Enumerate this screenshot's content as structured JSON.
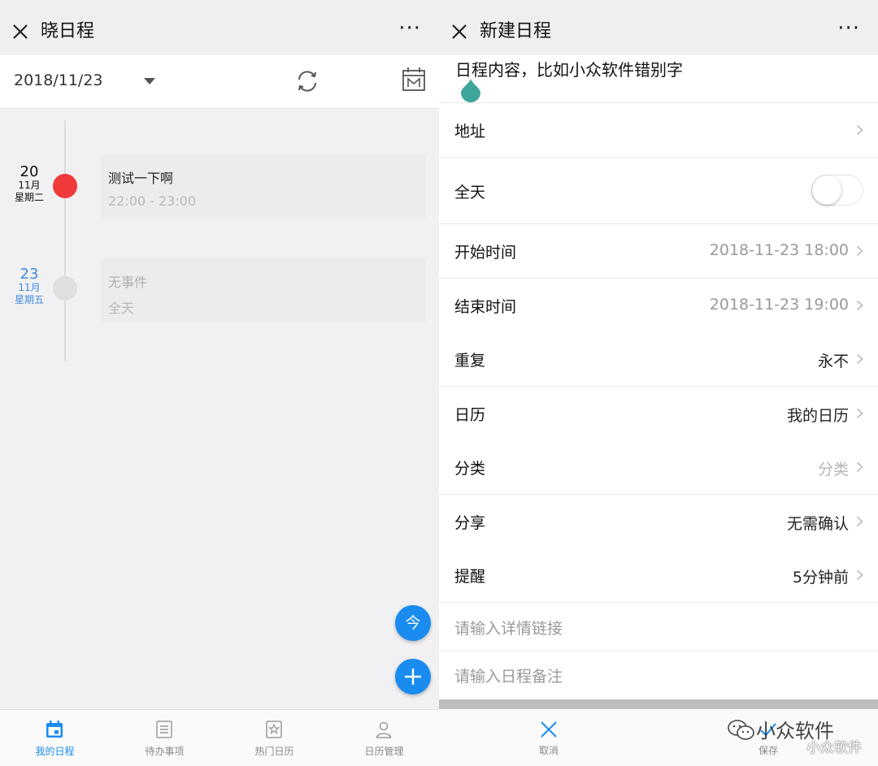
{
  "left": {
    "app_title": "晓日程",
    "more_label": "···",
    "date_selector": "2018/11/23",
    "events": [
      {
        "day": "20",
        "month": "11月",
        "weekday": "星期二",
        "title": "测试一下啊",
        "time": "22:00 - 23:00",
        "dot_color": "#f0393a"
      },
      {
        "day": "23",
        "month": "11月",
        "weekday": "星期五",
        "title": "无事件",
        "time": "全天",
        "dot_color": "#dfdfe2"
      }
    ],
    "fab_today": "今",
    "fab_add": "+",
    "nav": [
      {
        "label": "我的日程",
        "icon": "calendar-icon",
        "active": true
      },
      {
        "label": "待办事项",
        "icon": "list-icon",
        "active": false
      },
      {
        "label": "热门日历",
        "icon": "bookmark-icon",
        "active": false
      },
      {
        "label": "日历管理",
        "icon": "person-icon",
        "active": false
      }
    ],
    "accent_color": "#1a8cf0"
  },
  "right": {
    "title": "新建日程",
    "more_label": "···",
    "content_placeholder": "日程内容，比如小众软件错别字",
    "rows": {
      "address": {
        "label": "地址",
        "value": ""
      },
      "allday": {
        "label": "全天",
        "on": false
      },
      "start": {
        "label": "开始时间",
        "value": "2018-11-23 18:00"
      },
      "end": {
        "label": "结束时间",
        "value": "2018-11-23 19:00"
      },
      "repeat": {
        "label": "重复",
        "value": "永不"
      },
      "calendar": {
        "label": "日历",
        "value": "我的日历"
      },
      "category": {
        "label": "分类",
        "value": "分类"
      },
      "share": {
        "label": "分享",
        "value": "无需确认"
      },
      "reminder": {
        "label": "提醒",
        "value": "5分钟前"
      }
    },
    "link_placeholder": "请输入详情链接",
    "note_placeholder": "请输入日程备注",
    "cancel_label": "取消",
    "save_label": "保存",
    "watermark_main": "小众软件",
    "watermark_sub": "小众软件"
  }
}
